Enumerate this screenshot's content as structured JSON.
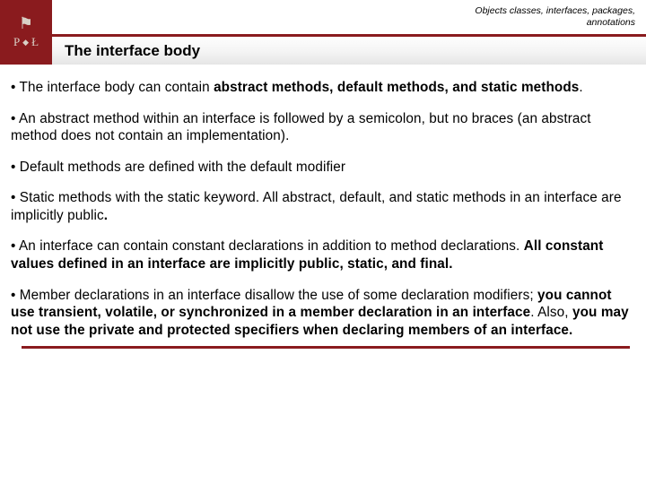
{
  "header": {
    "logo_top": "P",
    "logo_bottom": "Ł",
    "breadcrumb_line1": "Objects classes, interfaces, packages,",
    "breadcrumb_line2": "annotations",
    "title": "The interface body"
  },
  "paras": [
    {
      "pre": "• The interface body can contain ",
      "bold": "abstract methods, default methods, and static methods",
      "post": "."
    },
    {
      "text": "• An abstract method within an interface is followed by a semicolon, but no braces (an abstract method does not contain an implementation)."
    },
    {
      "text": "• Default methods are defined with the default modifier"
    },
    {
      "pre": "• Static methods with the static keyword. All abstract, default, and static methods in an interface are implicitly public",
      "bold": ".",
      "post": ""
    },
    {
      "pre": "• An interface can contain constant declarations in addition to method declarations. ",
      "bold": "All constant values defined in an interface are implicitly public, static, and final.",
      "post": ""
    },
    {
      "pre": "• Member declarations in an interface disallow the use of some declaration modifiers; ",
      "bold": "you cannot use transient, volatile, or synchronized in a member declaration in an interface",
      "mid": ". Also, ",
      "bold2": "you may not use the private and protected specifiers when declaring members of an interface.",
      "post": ""
    }
  ]
}
